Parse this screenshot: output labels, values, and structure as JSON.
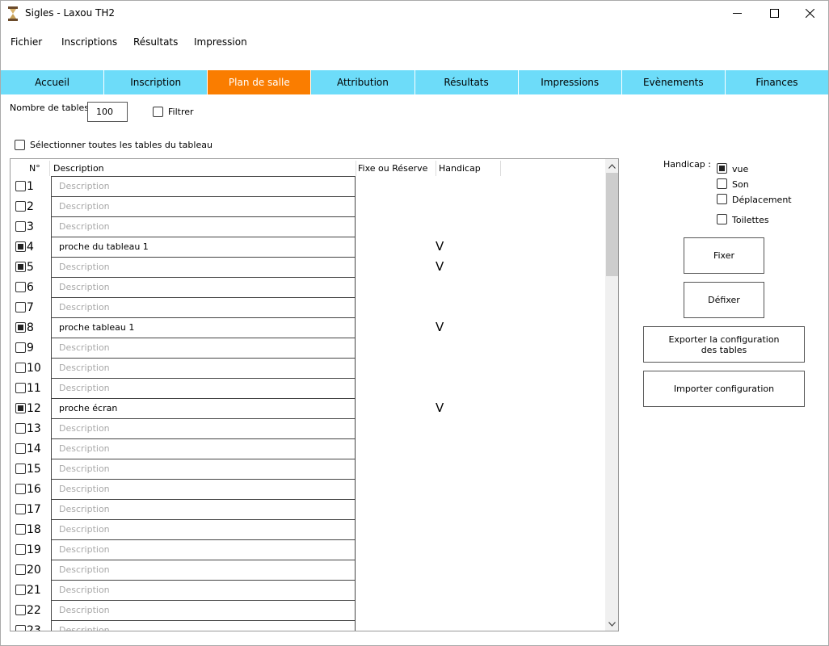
{
  "window": {
    "title": "Sigles - Laxou TH2"
  },
  "menu": [
    "Fichier",
    "Inscriptions",
    "Résultats",
    "Impression"
  ],
  "tabs": [
    {
      "label": "Accueil",
      "active": false
    },
    {
      "label": "Inscription",
      "active": false
    },
    {
      "label": "Plan de salle",
      "active": true
    },
    {
      "label": "Attribution",
      "active": false
    },
    {
      "label": "Résultats",
      "active": false
    },
    {
      "label": "Impressions",
      "active": false
    },
    {
      "label": "Evènements",
      "active": false
    },
    {
      "label": "Finances",
      "active": false
    }
  ],
  "controls": {
    "nb_tables_label": "Nombre de tables",
    "nb_tables_value": "100",
    "filter_label": "Filtrer",
    "select_all_label": "Sélectionner toutes les tables du tableau"
  },
  "table": {
    "headers": {
      "num": "N°",
      "description": "Description",
      "fixe": "Fixe ou Réserve",
      "handicap": "Handicap"
    },
    "placeholder": "Description",
    "rows": [
      {
        "num": "1",
        "checked": false,
        "description": "",
        "handicap": ""
      },
      {
        "num": "2",
        "checked": false,
        "description": "",
        "handicap": ""
      },
      {
        "num": "3",
        "checked": false,
        "description": "",
        "handicap": ""
      },
      {
        "num": "4",
        "checked": true,
        "description": "proche du tableau 1",
        "handicap": "V"
      },
      {
        "num": "5",
        "checked": true,
        "description": "",
        "handicap": "V"
      },
      {
        "num": "6",
        "checked": false,
        "description": "",
        "handicap": ""
      },
      {
        "num": "7",
        "checked": false,
        "description": "",
        "handicap": ""
      },
      {
        "num": "8",
        "checked": true,
        "description": "proche tableau 1",
        "handicap": "V"
      },
      {
        "num": "9",
        "checked": false,
        "description": "",
        "handicap": ""
      },
      {
        "num": "10",
        "checked": false,
        "description": "",
        "handicap": ""
      },
      {
        "num": "11",
        "checked": false,
        "description": "",
        "handicap": ""
      },
      {
        "num": "12",
        "checked": true,
        "description": "proche écran",
        "handicap": "V"
      },
      {
        "num": "13",
        "checked": false,
        "description": "",
        "handicap": ""
      },
      {
        "num": "14",
        "checked": false,
        "description": "",
        "handicap": ""
      },
      {
        "num": "15",
        "checked": false,
        "description": "",
        "handicap": ""
      },
      {
        "num": "16",
        "checked": false,
        "description": "",
        "handicap": ""
      },
      {
        "num": "17",
        "checked": false,
        "description": "",
        "handicap": ""
      },
      {
        "num": "18",
        "checked": false,
        "description": "",
        "handicap": ""
      },
      {
        "num": "19",
        "checked": false,
        "description": "",
        "handicap": ""
      },
      {
        "num": "20",
        "checked": false,
        "description": "",
        "handicap": ""
      },
      {
        "num": "21",
        "checked": false,
        "description": "",
        "handicap": ""
      },
      {
        "num": "22",
        "checked": false,
        "description": "",
        "handicap": ""
      },
      {
        "num": "23",
        "checked": false,
        "description": "",
        "handicap": ""
      }
    ]
  },
  "handicap_panel": {
    "label": "Handicap :",
    "options": [
      {
        "label": "vue",
        "checked": true
      },
      {
        "label": "Son",
        "checked": false
      },
      {
        "label": "Déplacement",
        "checked": false
      },
      {
        "label": "Toilettes",
        "checked": false
      }
    ]
  },
  "buttons": {
    "fixer": "Fixer",
    "defixer": "Défixer",
    "export_line1": "Exporter la configuration",
    "export_line2": "des tables",
    "import": "Importer configuration"
  },
  "colors": {
    "tab_bg": "#6ddcf9",
    "tab_active": "#fa7d00"
  }
}
